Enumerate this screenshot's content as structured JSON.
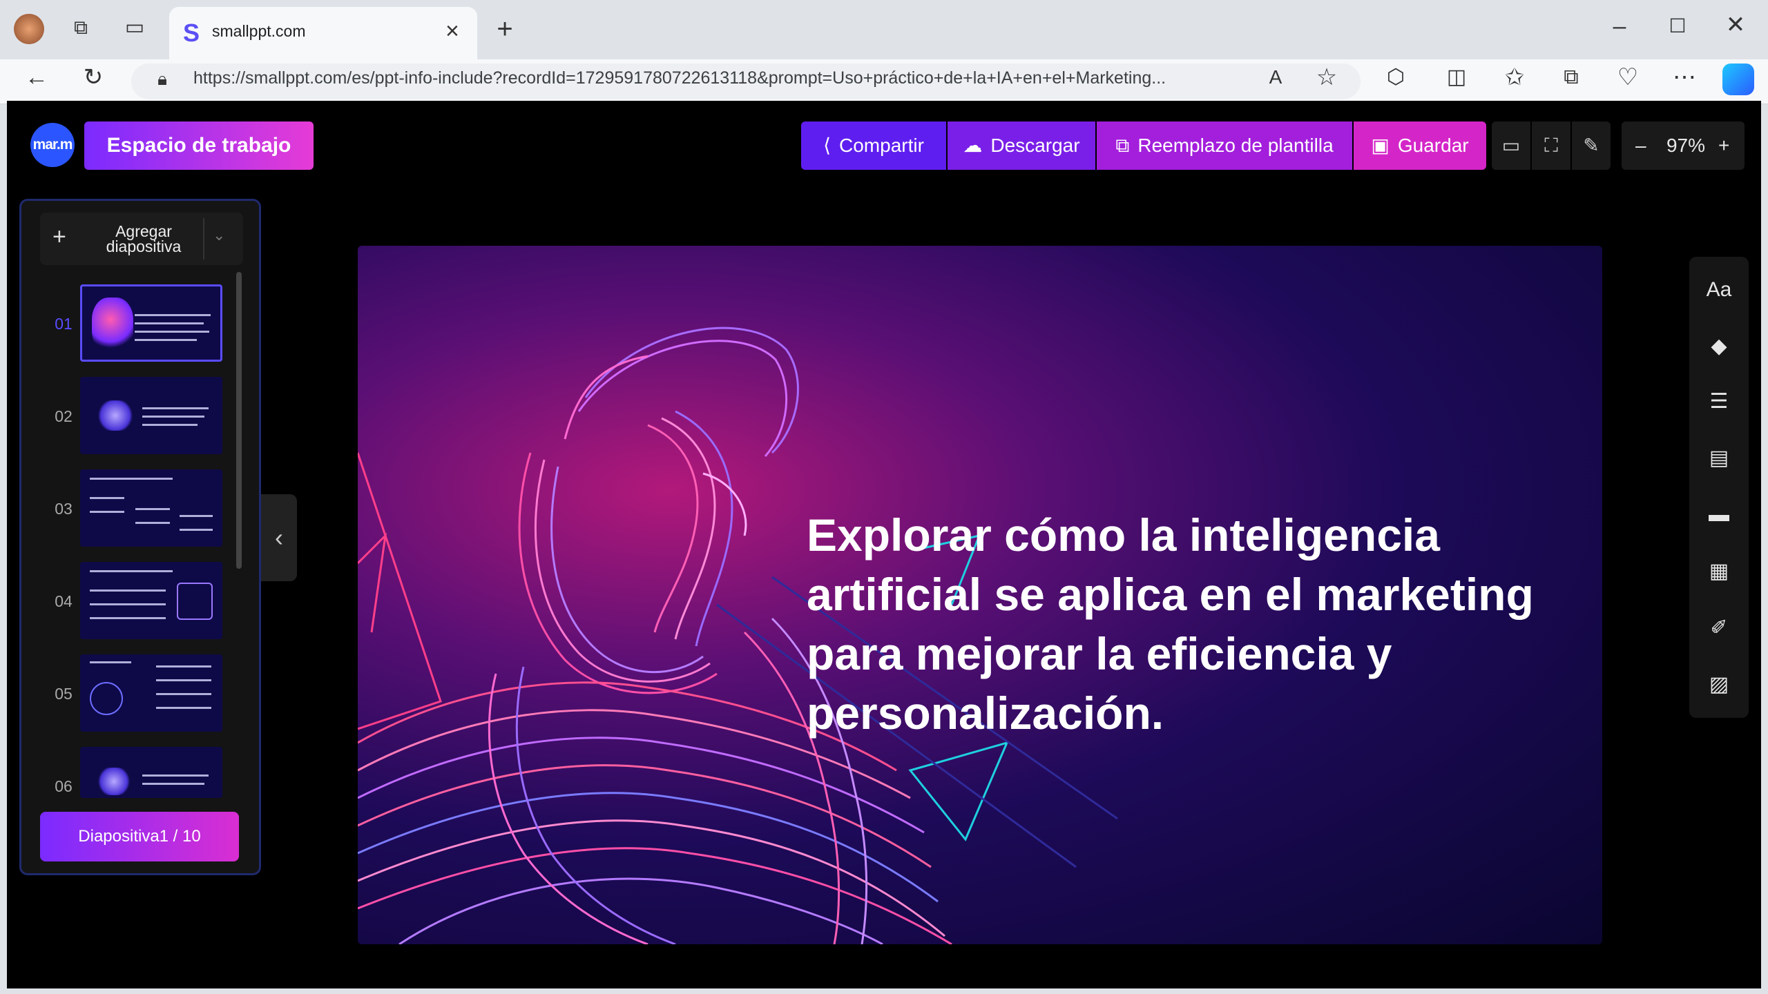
{
  "browser": {
    "tab_title": "smallppt.com",
    "favicon": "S",
    "url": "https://smallppt.com/es/ppt-info-include?recordId=1729591780722613118&prompt=Uso+práctico+de+la+IA+en+el+Marketing..."
  },
  "header": {
    "avatar_text": "mar.m",
    "workspace_label": "Espacio de trabajo",
    "share_label": "Compartir",
    "download_label": "Descargar",
    "replace_label": "Reemplazo de plantilla",
    "save_label": "Guardar",
    "zoom": "97%"
  },
  "panel": {
    "add_slide_label": "Agregar diapositiva",
    "slides": [
      {
        "num": "01"
      },
      {
        "num": "02"
      },
      {
        "num": "03"
      },
      {
        "num": "04"
      },
      {
        "num": "05"
      },
      {
        "num": "06"
      }
    ],
    "counter": "Diapositiva1 / 10"
  },
  "slide": {
    "title": "Explorar cómo la inteligencia artificial se aplica en el marketing para mejorar la eficiencia y personalización."
  },
  "colors": {
    "accent_start": "#7b2bff",
    "accent_end": "#e63bd6",
    "share": "#5f1ef0",
    "save": "#d426c8"
  }
}
